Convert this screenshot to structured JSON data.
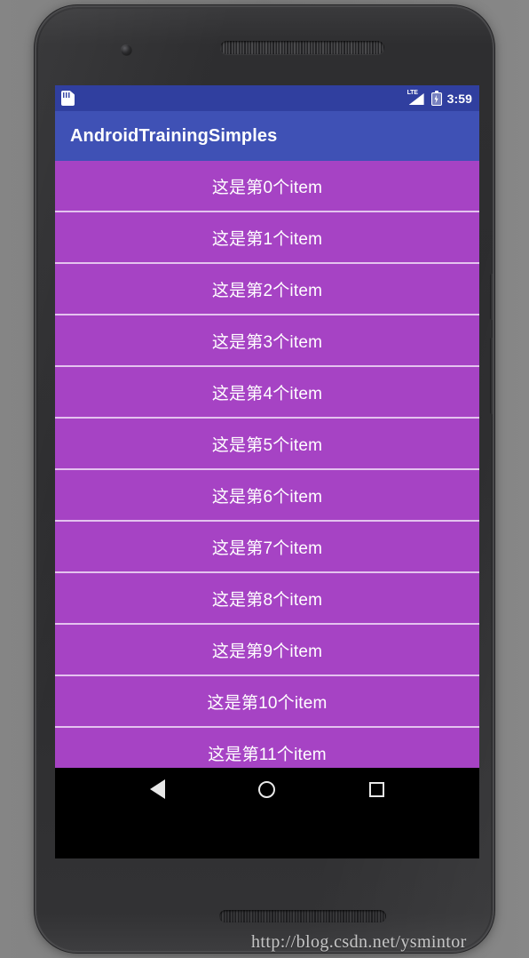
{
  "device": {
    "name": "android-phone",
    "hardware": {
      "front_camera": "front-camera",
      "earpiece": "earpiece-speaker",
      "bottom_speaker": "bottom-speaker-grille",
      "power_button": "power-button",
      "volume_button": "volume-button"
    }
  },
  "status_bar": {
    "background_color": "#303f9f",
    "left_icons": [
      {
        "name": "sd-card-icon",
        "label": "SD"
      }
    ],
    "network_label": "LTE",
    "right_icons": [
      {
        "name": "signal-icon",
        "label": "LTE"
      },
      {
        "name": "battery-charging-icon",
        "label": "Battery charging"
      }
    ],
    "clock": "3:59"
  },
  "app_bar": {
    "title": "AndroidTrainingSimples",
    "background_color": "#3f51b5",
    "text_color": "#ffffff"
  },
  "list": {
    "background_color": "#a643c4",
    "divider_color": "#e4c3ef",
    "text_color": "#ffffff",
    "items": [
      {
        "label": "这是第0个item"
      },
      {
        "label": "这是第1个item"
      },
      {
        "label": "这是第2个item"
      },
      {
        "label": "这是第3个item"
      },
      {
        "label": "这是第4个item"
      },
      {
        "label": "这是第5个item"
      },
      {
        "label": "这是第6个item"
      },
      {
        "label": "这是第7个item"
      },
      {
        "label": "这是第8个item"
      },
      {
        "label": "这是第9个item"
      },
      {
        "label": "这是第10个item"
      },
      {
        "label": "这是第11个item"
      }
    ]
  },
  "nav_bar": {
    "background_color": "#000000",
    "buttons": [
      {
        "name": "back-button",
        "icon": "triangle-left-icon"
      },
      {
        "name": "home-button",
        "icon": "circle-icon"
      },
      {
        "name": "recents-button",
        "icon": "square-icon"
      }
    ]
  },
  "watermark": {
    "text": "http://blog.csdn.net/ysmintor"
  }
}
